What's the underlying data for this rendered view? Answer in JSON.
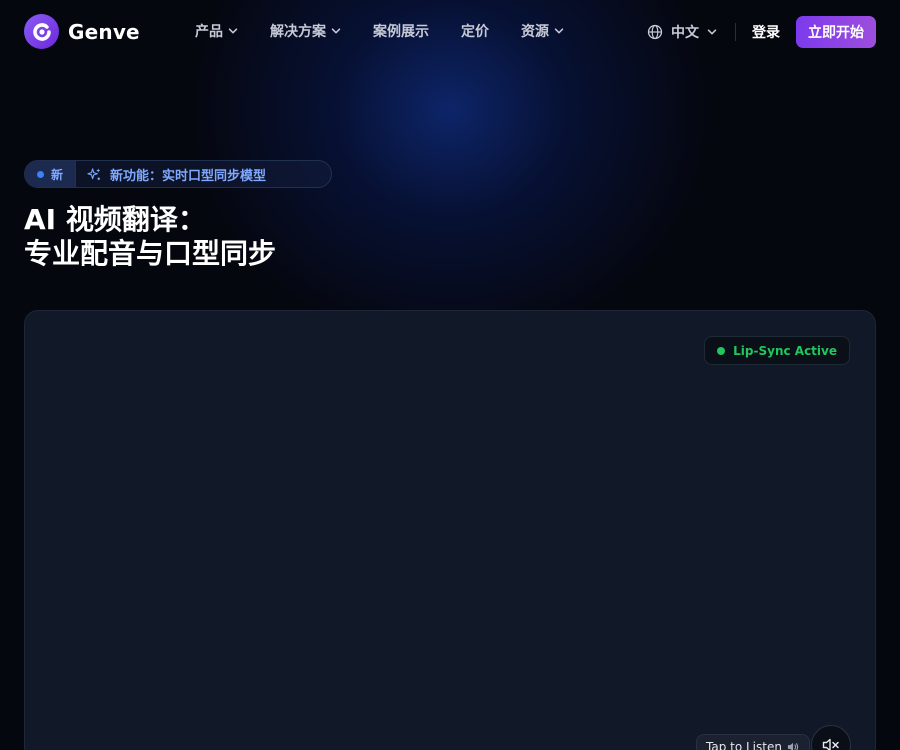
{
  "brand": {
    "name": "Genve"
  },
  "nav": {
    "items": [
      {
        "label": "产品",
        "has_dropdown": true
      },
      {
        "label": "解决方案",
        "has_dropdown": true
      },
      {
        "label": "案例展示",
        "has_dropdown": false
      },
      {
        "label": "定价",
        "has_dropdown": false
      },
      {
        "label": "资源",
        "has_dropdown": true
      }
    ],
    "language": "中文",
    "login": "登录",
    "cta": "立即开始"
  },
  "badge": {
    "tag": "新",
    "text": "新功能：实时口型同步模型"
  },
  "hero": {
    "title_line1": "AI 视频翻译：",
    "title_line2": "专业配音与口型同步"
  },
  "player": {
    "status": "Lip-Sync Active",
    "tap_label": "Tap to Listen"
  },
  "colors": {
    "background": "#05070f",
    "accent": "#7c3aed",
    "badge_text": "#7fa8ff",
    "status_green": "#22c55e",
    "panel": "#111827"
  },
  "icons": [
    "logo-icon",
    "chevron-down-icon",
    "globe-icon",
    "sparkles-icon",
    "speaker-icon",
    "mute-icon"
  ]
}
